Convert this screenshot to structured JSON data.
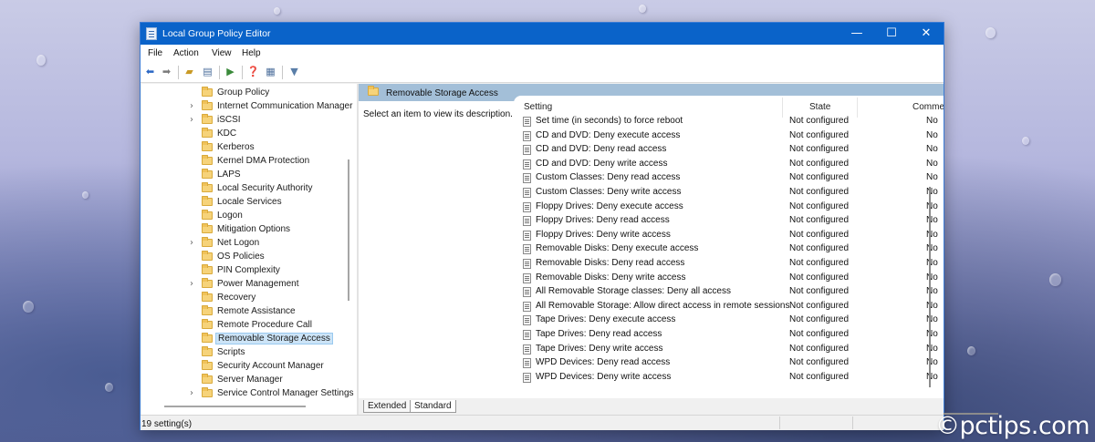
{
  "window": {
    "title": "Local Group Policy Editor"
  },
  "window_controls": {
    "minimize": "—",
    "maximize": "☐",
    "close": "✕"
  },
  "menu": [
    "File",
    "Action",
    "View",
    "Help"
  ],
  "tree": {
    "items": [
      {
        "label": "Group Policy",
        "expandable": false,
        "selected": false
      },
      {
        "label": "Internet Communication Manager",
        "expandable": true,
        "selected": false
      },
      {
        "label": "iSCSI",
        "expandable": true,
        "selected": false
      },
      {
        "label": "KDC",
        "expandable": false,
        "selected": false
      },
      {
        "label": "Kerberos",
        "expandable": false,
        "selected": false
      },
      {
        "label": "Kernel DMA Protection",
        "expandable": false,
        "selected": false
      },
      {
        "label": "LAPS",
        "expandable": false,
        "selected": false
      },
      {
        "label": "Local Security Authority",
        "expandable": false,
        "selected": false
      },
      {
        "label": "Locale Services",
        "expandable": false,
        "selected": false
      },
      {
        "label": "Logon",
        "expandable": false,
        "selected": false
      },
      {
        "label": "Mitigation Options",
        "expandable": false,
        "selected": false
      },
      {
        "label": "Net Logon",
        "expandable": true,
        "selected": false
      },
      {
        "label": "OS Policies",
        "expandable": false,
        "selected": false
      },
      {
        "label": "PIN Complexity",
        "expandable": false,
        "selected": false
      },
      {
        "label": "Power Management",
        "expandable": true,
        "selected": false
      },
      {
        "label": "Recovery",
        "expandable": false,
        "selected": false
      },
      {
        "label": "Remote Assistance",
        "expandable": false,
        "selected": false
      },
      {
        "label": "Remote Procedure Call",
        "expandable": false,
        "selected": false
      },
      {
        "label": "Removable Storage Access",
        "expandable": false,
        "selected": true
      },
      {
        "label": "Scripts",
        "expandable": false,
        "selected": false
      },
      {
        "label": "Security Account Manager",
        "expandable": false,
        "selected": false
      },
      {
        "label": "Server Manager",
        "expandable": false,
        "selected": false
      },
      {
        "label": "Service Control Manager Settings",
        "expandable": true,
        "selected": false
      }
    ],
    "expand_glyph": "›"
  },
  "right_pane": {
    "header": "Removable Storage Access",
    "description": "Select an item to view its description.",
    "columns": {
      "setting": "Setting",
      "state": "State",
      "comment": "Comment"
    },
    "rows": [
      {
        "setting": "Set time (in seconds) to force reboot",
        "state": "Not configured",
        "comment": "No"
      },
      {
        "setting": "CD and DVD: Deny execute access",
        "state": "Not configured",
        "comment": "No"
      },
      {
        "setting": "CD and DVD: Deny read access",
        "state": "Not configured",
        "comment": "No"
      },
      {
        "setting": "CD and DVD: Deny write access",
        "state": "Not configured",
        "comment": "No"
      },
      {
        "setting": "Custom Classes: Deny read access",
        "state": "Not configured",
        "comment": "No"
      },
      {
        "setting": "Custom Classes: Deny write access",
        "state": "Not configured",
        "comment": "No"
      },
      {
        "setting": "Floppy Drives: Deny execute access",
        "state": "Not configured",
        "comment": "No"
      },
      {
        "setting": "Floppy Drives: Deny read access",
        "state": "Not configured",
        "comment": "No"
      },
      {
        "setting": "Floppy Drives: Deny write access",
        "state": "Not configured",
        "comment": "No"
      },
      {
        "setting": "Removable Disks: Deny execute access",
        "state": "Not configured",
        "comment": "No"
      },
      {
        "setting": "Removable Disks: Deny read access",
        "state": "Not configured",
        "comment": "No"
      },
      {
        "setting": "Removable Disks: Deny write access",
        "state": "Not configured",
        "comment": "No"
      },
      {
        "setting": "All Removable Storage classes: Deny all access",
        "state": "Not configured",
        "comment": "No"
      },
      {
        "setting": "All Removable Storage: Allow direct access in remote sessions",
        "state": "Not configured",
        "comment": "No"
      },
      {
        "setting": "Tape Drives: Deny execute access",
        "state": "Not configured",
        "comment": "No"
      },
      {
        "setting": "Tape Drives: Deny read access",
        "state": "Not configured",
        "comment": "No"
      },
      {
        "setting": "Tape Drives: Deny write access",
        "state": "Not configured",
        "comment": "No"
      },
      {
        "setting": "WPD Devices: Deny read access",
        "state": "Not configured",
        "comment": "No"
      },
      {
        "setting": "WPD Devices: Deny write access",
        "state": "Not configured",
        "comment": "No"
      }
    ]
  },
  "tabs": [
    "Extended",
    "Standard"
  ],
  "status": {
    "text": "19 setting(s)"
  },
  "watermark": "©pctips.com",
  "colors": {
    "titlebar": "#0a63c9",
    "pane_header": "#a3bfd8",
    "selection": "#cce4f7"
  }
}
